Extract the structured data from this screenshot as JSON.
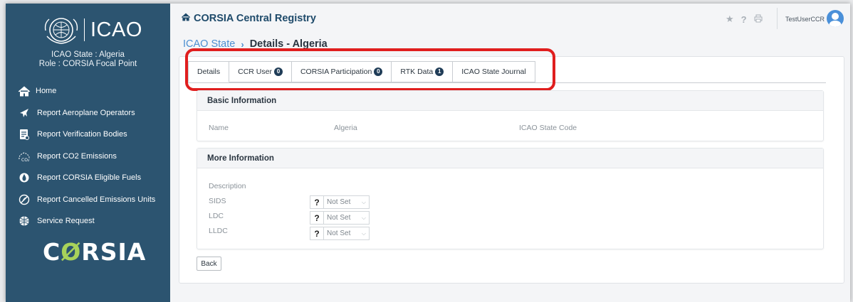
{
  "sidebar": {
    "logo_text": "ICAO",
    "state_line": "ICAO State : Algeria",
    "role_line": "Role : CORSIA Focal Point",
    "menu": [
      {
        "label": "Home",
        "icon": "home-icon"
      },
      {
        "label": "Report Aeroplane Operators",
        "icon": "airplane-icon"
      },
      {
        "label": "Report Verification Bodies",
        "icon": "document-icon"
      },
      {
        "label": "Report CO2 Emissions",
        "icon": "co2-icon"
      },
      {
        "label": "Report CORSIA Eligible Fuels",
        "icon": "fuel-drop-icon"
      },
      {
        "label": "Report Cancelled Emissions Units",
        "icon": "cancelled-icon"
      },
      {
        "label": "Service Request",
        "icon": "service-globe-icon"
      }
    ],
    "corsia_logo_pre": "C",
    "corsia_logo_o": "Ø",
    "corsia_logo_post": "RSIA"
  },
  "header": {
    "title": "CORSIA Central Registry",
    "username": "TestUserCCR"
  },
  "breadcrumb": {
    "link": "ICAO State",
    "current": "Details - Algeria"
  },
  "tabs": [
    {
      "label": "Details",
      "badge": null
    },
    {
      "label": "CCR User",
      "badge": "0"
    },
    {
      "label": "CORSIA Participation",
      "badge": "0"
    },
    {
      "label": "RTK Data",
      "badge": "1"
    },
    {
      "label": "ICAO State Journal",
      "badge": null
    }
  ],
  "basic_info": {
    "heading": "Basic Information",
    "name_label": "Name",
    "name_value": "Algeria",
    "code_label": "ICAO State Code",
    "code_value": ""
  },
  "more_info": {
    "heading": "More Information",
    "description_label": "Description",
    "rows": [
      {
        "label": "SIDS",
        "value": "Not Set"
      },
      {
        "label": "LDC",
        "value": "Not Set"
      },
      {
        "label": "LLDC",
        "value": "Not Set"
      }
    ],
    "help_glyph": "?"
  },
  "back_label": "Back",
  "colors": {
    "sidebar_bg": "#2c5470",
    "accent_link": "#4c8fd1",
    "highlight": "#e01e1e"
  }
}
